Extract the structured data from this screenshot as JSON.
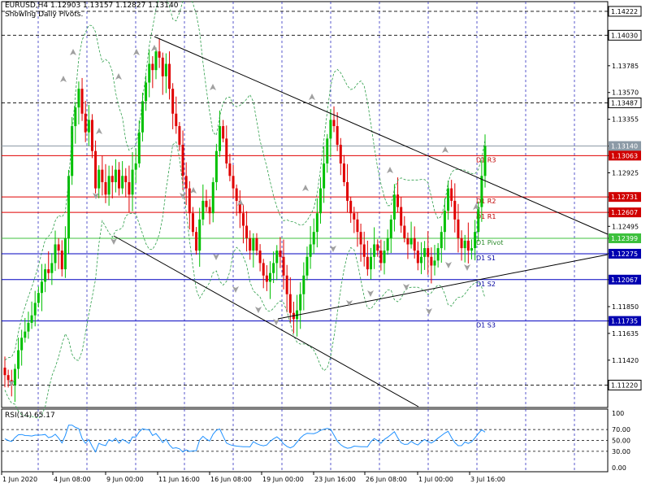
{
  "header": {
    "symbol_line": "EURUSD,H4  1.12903 1.13157 1.12827 1.13140",
    "pivots_note": "Showing Daily Pivots."
  },
  "rsi_label": "RSI(14) 65.17",
  "colors": {
    "up_candle": "#00c000",
    "down_candle": "#e00000",
    "bollinger": "#2e9e4a",
    "resistance": "#e00000",
    "pivot": "#3cc03c",
    "support": "#0000c0",
    "rsi_line": "#1e90ff",
    "fractal": "#a0a0a0"
  },
  "chart_data": [
    {
      "type": "candlestick",
      "symbol": "EURUSD",
      "timeframe": "H4",
      "ylim": [
        1.1104,
        1.143
      ],
      "y_ticks": [
        1.14222,
        1.1403,
        1.13785,
        1.1357,
        1.13487,
        1.13355,
        1.1314,
        1.13063,
        1.12925,
        1.12731,
        1.12607,
        1.12495,
        1.12399,
        1.12275,
        1.12067,
        1.1185,
        1.11735,
        1.11635,
        1.1142,
        1.1122
      ],
      "price_tags": [
        {
          "value": "1.14222",
          "style": "box"
        },
        {
          "value": "1.14030",
          "style": "box"
        },
        {
          "value": "1.13785",
          "style": "plain"
        },
        {
          "value": "1.13570",
          "style": "plain"
        },
        {
          "value": "1.13487",
          "style": "box"
        },
        {
          "value": "1.13355",
          "style": "plain"
        },
        {
          "value": "1.13140",
          "style": "current"
        },
        {
          "value": "1.13063",
          "style": "resistance"
        },
        {
          "value": "1.12925",
          "style": "plain"
        },
        {
          "value": "1.12731",
          "style": "resistance"
        },
        {
          "value": "1.12607",
          "style": "resistance"
        },
        {
          "value": "1.12495",
          "style": "plain"
        },
        {
          "value": "1.12399",
          "style": "pivot"
        },
        {
          "value": "1.12275",
          "style": "support"
        },
        {
          "value": "1.12067",
          "style": "support"
        },
        {
          "value": "1.11850",
          "style": "plain"
        },
        {
          "value": "1.11735",
          "style": "support"
        },
        {
          "value": "1.11635",
          "style": "plain"
        },
        {
          "value": "1.11420",
          "style": "plain"
        },
        {
          "value": "1.11220",
          "style": "box"
        }
      ],
      "x_labels": [
        "1 Jun 2020",
        "4 Jun 08:00",
        "9 Jun 00:00",
        "11 Jun 16:00",
        "16 Jun 08:00",
        "19 Jun 00:00",
        "23 Jun 16:00",
        "26 Jun 08:00",
        "1 Jul 00:00",
        "3 Jul 16:00"
      ],
      "daily_pivots": [
        {
          "label": "D1  R3",
          "value": 1.13063,
          "kind": "resistance"
        },
        {
          "label": "D1  R2",
          "value": 1.12731,
          "kind": "resistance"
        },
        {
          "label": "D1  R1",
          "value": 1.12607,
          "kind": "resistance"
        },
        {
          "label": "D1  Pivot",
          "value": 1.12399,
          "kind": "pivot"
        },
        {
          "label": "D1  S1",
          "value": 1.12275,
          "kind": "support"
        },
        {
          "label": "D1  S2",
          "value": 1.12067,
          "kind": "support"
        },
        {
          "label": "D1  S3",
          "value": 1.11735,
          "kind": "support"
        }
      ],
      "dashed_levels": [
        1.14222,
        1.1403,
        1.13487,
        1.1122
      ],
      "current_price": 1.1314,
      "close_series": [
        1.113,
        1.1126,
        1.1122,
        1.1135,
        1.115,
        1.116,
        1.1165,
        1.1172,
        1.1178,
        1.1188,
        1.1196,
        1.1205,
        1.1215,
        1.1212,
        1.122,
        1.1235,
        1.123,
        1.1215,
        1.124,
        1.129,
        1.133,
        1.1345,
        1.136,
        1.134,
        1.1325,
        1.1335,
        1.131,
        1.128,
        1.1295,
        1.1285,
        1.1275,
        1.129,
        1.1285,
        1.1295,
        1.128,
        1.129,
        1.1285,
        1.1275,
        1.1295,
        1.13,
        1.1325,
        1.135,
        1.1365,
        1.138,
        1.1375,
        1.139,
        1.1385,
        1.137,
        1.138,
        1.136,
        1.134,
        1.133,
        1.1315,
        1.129,
        1.128,
        1.126,
        1.1245,
        1.123,
        1.1255,
        1.127,
        1.1265,
        1.126,
        1.1285,
        1.131,
        1.133,
        1.132,
        1.13,
        1.129,
        1.128,
        1.127,
        1.126,
        1.125,
        1.124,
        1.123,
        1.124,
        1.123,
        1.122,
        1.121,
        1.1205,
        1.1212,
        1.122,
        1.123,
        1.1225,
        1.121,
        1.1195,
        1.118,
        1.1175,
        1.1182,
        1.1195,
        1.121,
        1.1225,
        1.1235,
        1.1245,
        1.126,
        1.128,
        1.13,
        1.132,
        1.1335,
        1.133,
        1.1315,
        1.13,
        1.1285,
        1.127,
        1.126,
        1.1255,
        1.1245,
        1.1235,
        1.1225,
        1.1215,
        1.1225,
        1.1235,
        1.123,
        1.122,
        1.123,
        1.124,
        1.1255,
        1.1275,
        1.1265,
        1.125,
        1.124,
        1.1235,
        1.124,
        1.123,
        1.122,
        1.1225,
        1.1232,
        1.1225,
        1.1218,
        1.1222,
        1.1232,
        1.1245,
        1.1262,
        1.128,
        1.127,
        1.1255,
        1.124,
        1.1232,
        1.1238,
        1.123,
        1.1232,
        1.1245,
        1.1265,
        1.129,
        1.1314
      ],
      "rsi": {
        "ylim": [
          0,
          100
        ],
        "levels": [
          70,
          50,
          30
        ],
        "last": 65.17
      }
    }
  ]
}
